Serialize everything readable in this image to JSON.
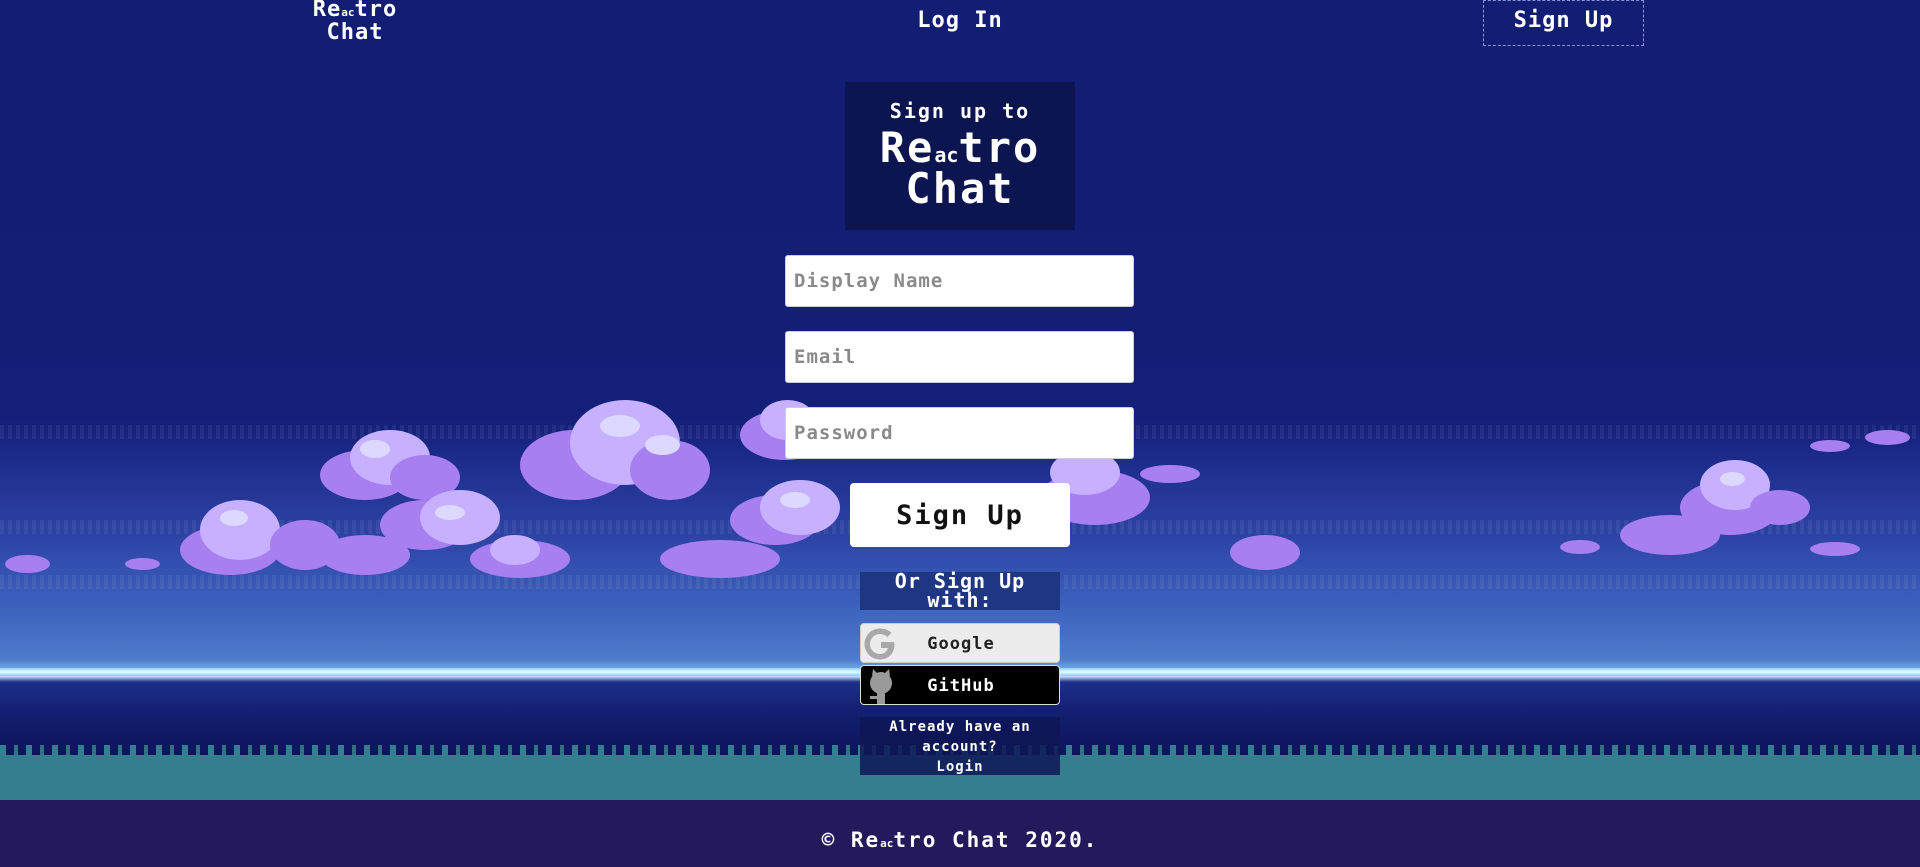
{
  "nav": {
    "brand_line1": "Re",
    "brand_small": "ac",
    "brand_line1_end": "tro",
    "brand_line2": "Chat",
    "login_label": "Log In",
    "signup_label": "Sign Up"
  },
  "title_card": {
    "heading": "Sign up to",
    "logo_pre": "Re",
    "logo_small": "ac",
    "logo_post": "tro",
    "logo_line2": "Chat"
  },
  "form": {
    "display_name_placeholder": "Display Name",
    "email_placeholder": "Email",
    "password_placeholder": "Password",
    "submit_label": "Sign Up"
  },
  "social": {
    "heading": "Or Sign Up with:",
    "google_label": "Google",
    "github_label": "GitHub"
  },
  "already": {
    "text": "Already have an account?",
    "login_link": "Login"
  },
  "footer": {
    "pre": "© Re",
    "small": "ac",
    "post": "tro Chat 2020."
  },
  "colors": {
    "sky": "#121e73",
    "title_card": "#0c154f",
    "cloud": "#a77ff0",
    "grass": "#347f8f"
  }
}
